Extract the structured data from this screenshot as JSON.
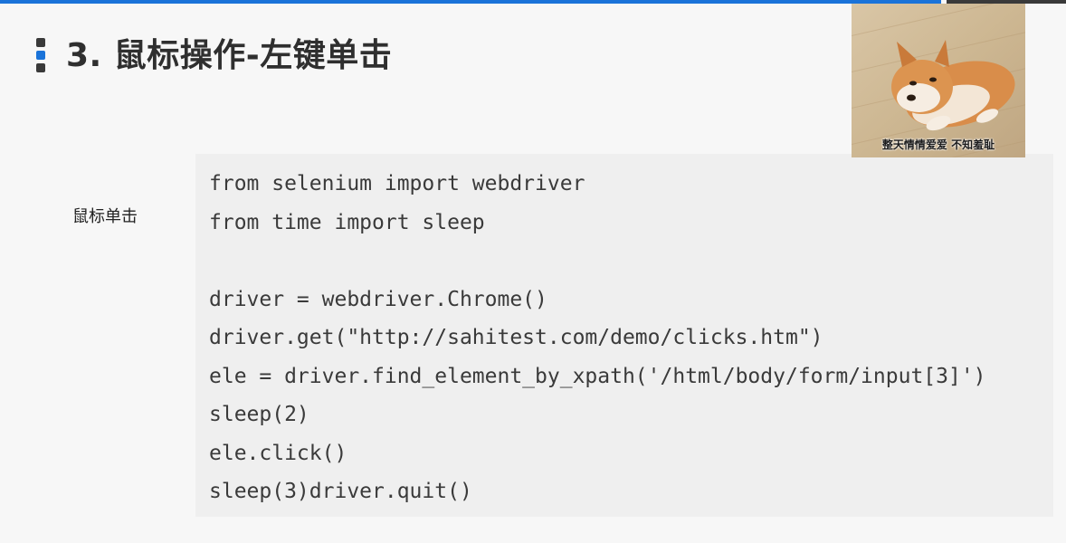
{
  "slide": {
    "title": "3. 鼠标操作-左键单击",
    "side_label": "鼠标单击"
  },
  "code": {
    "lines": [
      "from selenium import webdriver",
      "from time import sleep",
      "",
      "driver = webdriver.Chrome()",
      "driver.get(\"http://sahitest.com/demo/clicks.htm\")",
      "ele = driver.find_element_by_xpath('/html/body/form/input[3]')",
      "sleep(2)",
      "ele.click()",
      "sleep(3)driver.quit()"
    ]
  },
  "meme": {
    "caption": "整天情情爱爱   不知羞耻"
  },
  "colors": {
    "accent": "#1a73d9",
    "title_text": "#2f2f2f",
    "code_background": "#efefef",
    "page_background": "#f7f7f7"
  }
}
